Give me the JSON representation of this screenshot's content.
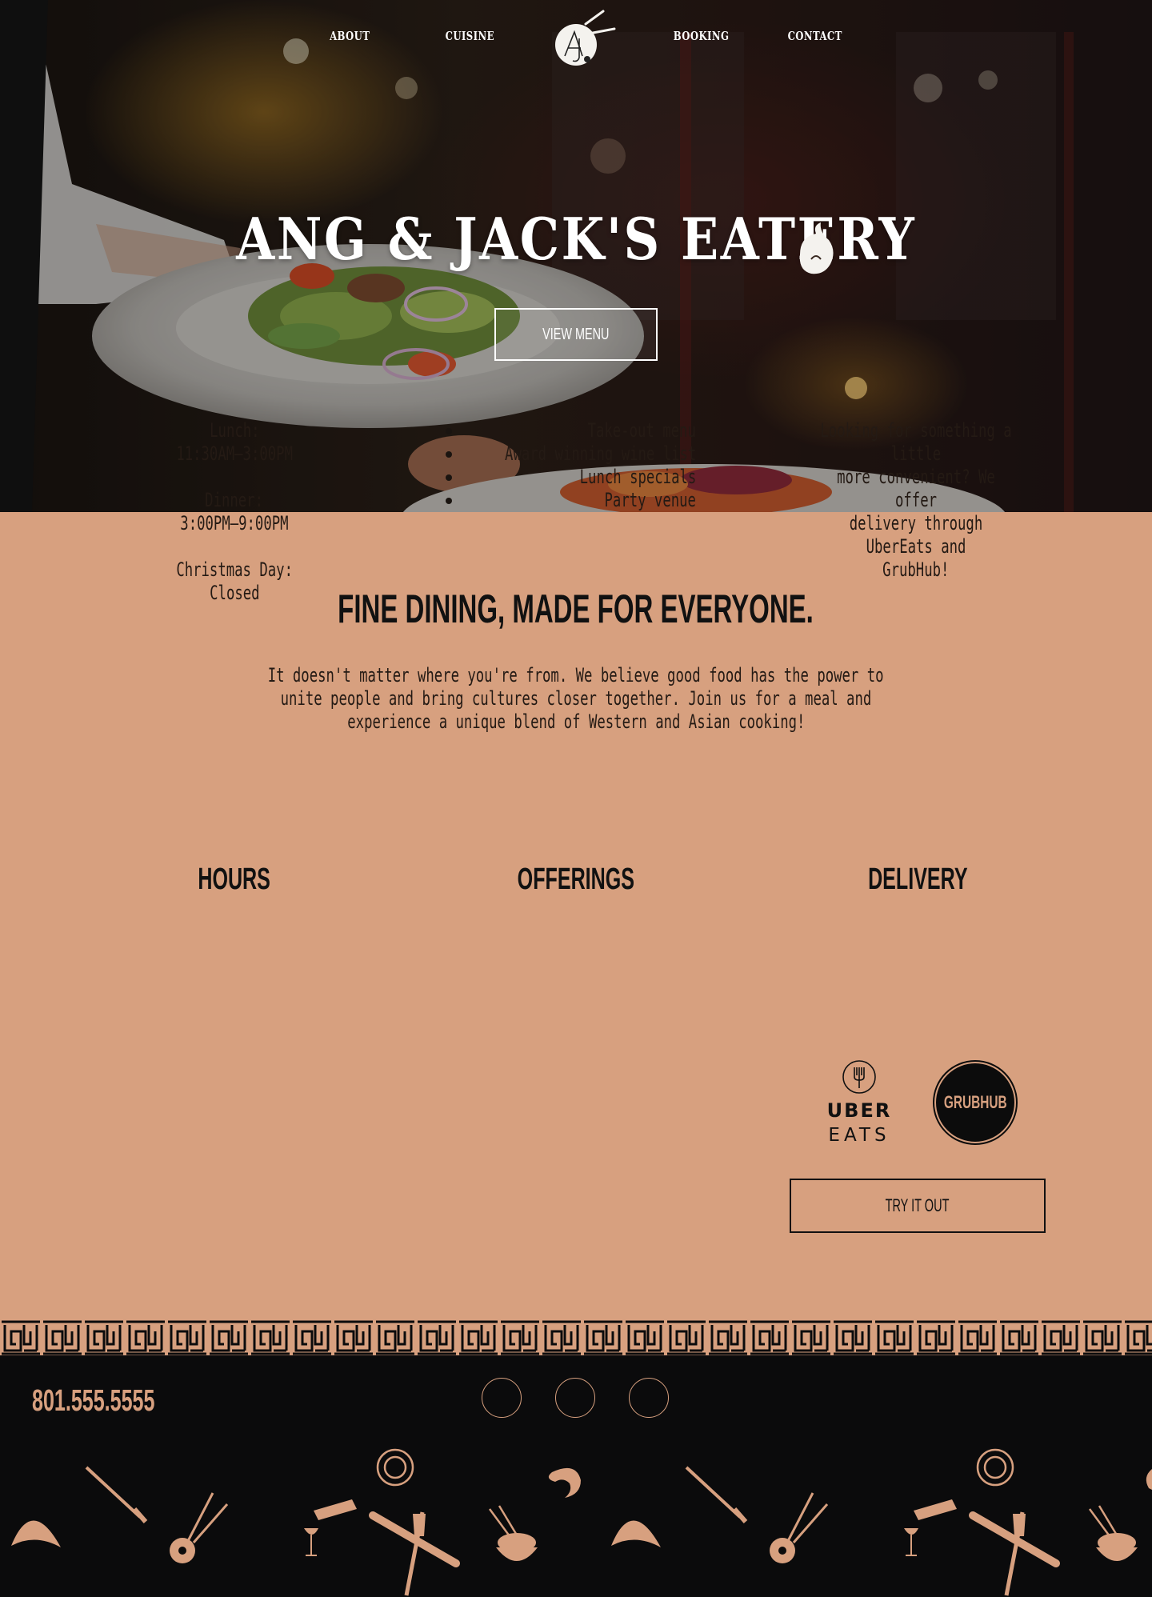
{
  "nav": {
    "items": [
      "ABOUT",
      "CUISINE",
      "BOOKING",
      "CONTACT"
    ]
  },
  "hero": {
    "title": "ANG & JACK'S EATERY",
    "button_label": "VIEW MENU"
  },
  "intro": {
    "heading": "FINE DINING, MADE FOR EVERYONE.",
    "lines": [
      "It doesn't matter where you're from. We believe good food has the power to",
      "unite people and bring cultures closer together. Join us for a meal and",
      "experience a unique blend of Western and Asian cooking!"
    ]
  },
  "hours": {
    "heading": "HOURS",
    "entries": [
      {
        "label": "Lunch:",
        "time": "11:30AM—3:00PM"
      },
      {
        "label": "Dinner:",
        "time": "3:00PM—9:00PM"
      },
      {
        "label": "Christmas Day:",
        "time": "Closed"
      }
    ]
  },
  "offerings": {
    "heading": "OFFERINGS",
    "items": [
      "Take-out menu",
      "Award winning wine list",
      "Lunch specials",
      "Party venue"
    ]
  },
  "delivery": {
    "heading": "DELIVERY",
    "lines": [
      "Looking for something a little",
      "more convenient? We offer",
      "delivery through UberEats and",
      "GrubHub!"
    ],
    "uber_line1": "UBER",
    "uber_line2": "EATS",
    "grubhub": "GRUBHUB",
    "button_label": "TRY IT OUT"
  },
  "footer": {
    "phone": "801.555.5555",
    "social_icons": [
      "social-icon-1",
      "social-icon-2",
      "social-icon-3"
    ]
  },
  "colors": {
    "accent": "#d7a07f",
    "dark": "#0b0b0c",
    "text": "#111111"
  }
}
